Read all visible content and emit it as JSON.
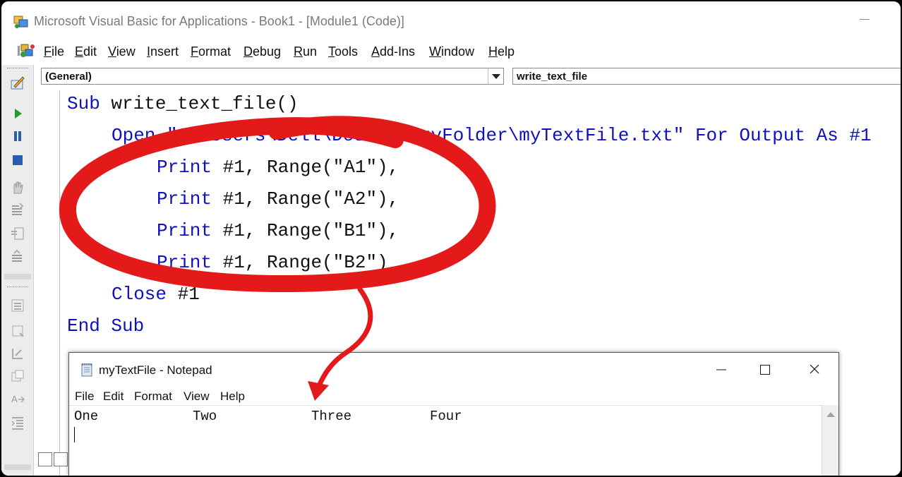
{
  "window": {
    "title": "Microsoft Visual Basic for Applications - Book1 - [Module1 (Code)]"
  },
  "menu": {
    "items": [
      "File",
      "Edit",
      "View",
      "Insert",
      "Format",
      "Debug",
      "Run",
      "Tools",
      "Add-Ins",
      "Window",
      "Help"
    ]
  },
  "code_window": {
    "object_combo": "(General)",
    "procedure_combo": "write_text_file",
    "lines": [
      {
        "keyword": "Sub",
        "rest": " write_text_file()"
      },
      {
        "keyword": "Open",
        "rest": " \"C:\\Users\\Dell\\Desktop\\myFolder\\myTextFile.txt\" For Output As #1"
      },
      {
        "keyword": "Print",
        "rest": " #1, Range(\"A1\"),"
      },
      {
        "keyword": "Print",
        "rest": " #1, Range(\"A2\"),"
      },
      {
        "keyword": "Print",
        "rest": " #1, Range(\"B1\"),"
      },
      {
        "keyword": "Print",
        "rest": " #1, Range(\"B2\")"
      },
      {
        "keyword": "Close",
        "rest": " #1"
      },
      {
        "keyword": "End Sub",
        "rest": ""
      }
    ]
  },
  "notepad": {
    "title": "myTextFile - Notepad",
    "menu": [
      "File",
      "Edit",
      "Format",
      "View",
      "Help"
    ],
    "content": [
      "One",
      "Two",
      "Three",
      "Four"
    ]
  },
  "colors": {
    "keyword": "#1010c0",
    "annotation": "#e41a1a"
  }
}
